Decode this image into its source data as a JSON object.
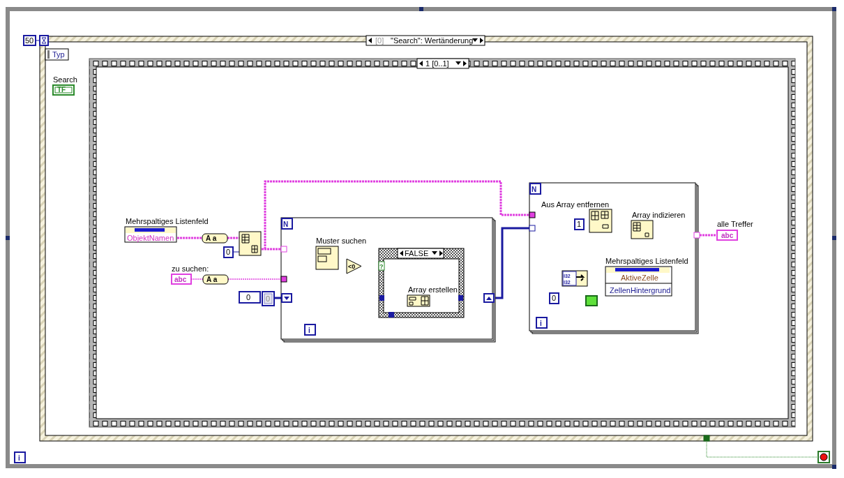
{
  "while_loop": {
    "iteration": "i"
  },
  "event_structure": {
    "timeout": "50",
    "selector_index": "[0]",
    "selector_case": "\"Search\": Wertänderung",
    "event_data": "Typ",
    "terminal_label": "Search",
    "terminal_type": "TF"
  },
  "sequence": {
    "frame": "1 [0..1]"
  },
  "listbox_names": {
    "label": "Mehrspaltiges Listenfeld",
    "property": "ObjektNamen",
    "case_glyph": "A a",
    "index_constant": "0"
  },
  "search_input": {
    "label": "zu suchen:",
    "type": "abc",
    "case_glyph": "A a"
  },
  "start_values": {
    "numeric": "0",
    "array": "0"
  },
  "search_loop": {
    "count": "N",
    "iteration": "i",
    "match_label": "Muster suchen",
    "compare": "<0",
    "selector": "?",
    "case": "FALSE",
    "build_label": "Array erstellen"
  },
  "highlight_loop": {
    "count": "N",
    "iteration": "i",
    "delete_label": "Aus Array entfernen",
    "delete_length": "1",
    "index_label": "Array indizieren",
    "bundle_types": [
      "I32",
      "I32"
    ],
    "zero_constant": "0",
    "property_label": "Mehrspaltiges Listenfeld",
    "properties": [
      "AktiveZelle",
      "ZellenHintergrund"
    ]
  },
  "output": {
    "label": "alle Treffer",
    "type": "abc"
  }
}
